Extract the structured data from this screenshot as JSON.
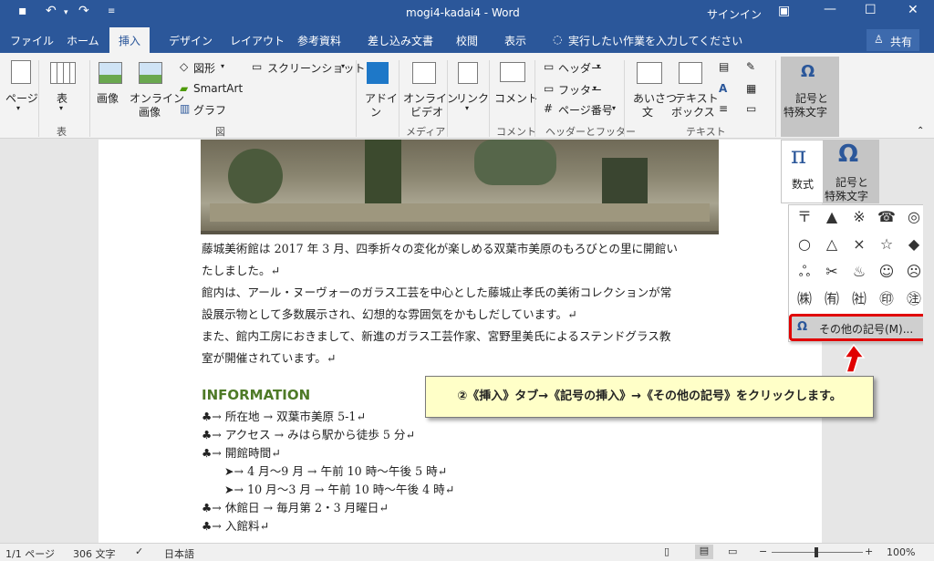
{
  "title": {
    "doc_name": "mogi4-kadai4 - Word",
    "signin": "サインイン"
  },
  "tabs": [
    "ファイル",
    "ホーム",
    "挿入",
    "デザイン",
    "レイアウト",
    "参考資料",
    "差し込み文書",
    "校閲",
    "表示"
  ],
  "tell_me": "実行したい作業を入力してください",
  "share": "共有",
  "ribbon": {
    "page": "ページ",
    "table": "表",
    "image": "画像",
    "online_image": [
      "オンライン",
      "画像"
    ],
    "shapes": "図形",
    "smartart": "SmartArt",
    "graph": "グラフ",
    "screenshot": "スクリーンショット",
    "addin": [
      "アドイ",
      "ン"
    ],
    "online_video": [
      "オンライン",
      "ビデオ"
    ],
    "link": "リンク",
    "comment": "コメント",
    "header": "ヘッダー",
    "footer": "フッター",
    "page_number": "ページ番号",
    "aisatsu": [
      "あいさつ",
      "文"
    ],
    "textbox": [
      "テキスト",
      "ボックス"
    ],
    "symbol": [
      "記号と",
      "特殊文字"
    ],
    "groups": {
      "table": "表",
      "figure": "図",
      "media": "メディア",
      "comment": "コメント",
      "header_footer": "ヘッダーとフッター",
      "text": "テキスト"
    }
  },
  "dropdown": {
    "equation": "数式",
    "symbol": [
      "記号と",
      "特殊文字"
    ],
    "symbols": [
      "〒",
      "▲",
      "※",
      "☎",
      "◎",
      "○",
      "△",
      "×",
      "☆",
      "◆",
      "ஃ",
      "✂",
      "♨",
      "☺",
      "☹",
      "㈱",
      "㈲",
      "㈳",
      "㊞",
      "㊟"
    ],
    "more_symbols": "その他の記号(M)..."
  },
  "document": {
    "paragraphs": [
      "藤城美術館は 2017 年 3 月、四季折々の変化が楽しめる双葉市美原のもろびとの里に開館い",
      "たしました。↵",
      "館内は、アール・ヌーヴォーのガラス工芸を中心とした藤城止孝氏の美術コレクションが常",
      "設展示物として多数展示され、幻想的な雰囲気をかもしだしています。↵",
      "また、館内工房におきまして、新進のガラス工芸作家、宮野里美氏によるステンドグラス教",
      "室が開催されています。↵"
    ],
    "heading": "INFORMATION",
    "info": [
      "♣→ 所在地 → 双葉市美原 5-1↵",
      "♣→ アクセス → みはら駅から徒歩 5 分↵",
      "♣→ 開館時間↵",
      "➤→ 4 月～9 月 → 午前 10 時～午後 5 時↵",
      "➤→ 10 月～3 月 → 午前 10 時～午後 4 時↵",
      "♣→ 休館日 → 毎月第 2・3 月曜日↵",
      "♣→ 入館料↵"
    ]
  },
  "callout": "②《挿入》タブ→《記号の挿入》→《その他の記号》をクリックします。",
  "status": {
    "page": "1/1 ページ",
    "words": "306 文字",
    "lang": "日本語",
    "zoom": "100%"
  },
  "colors": {
    "accent": "#2b579a",
    "highlight_border": "#e00000",
    "heading_green": "#4e7a27",
    "callout_bg": "#ffffc8"
  }
}
